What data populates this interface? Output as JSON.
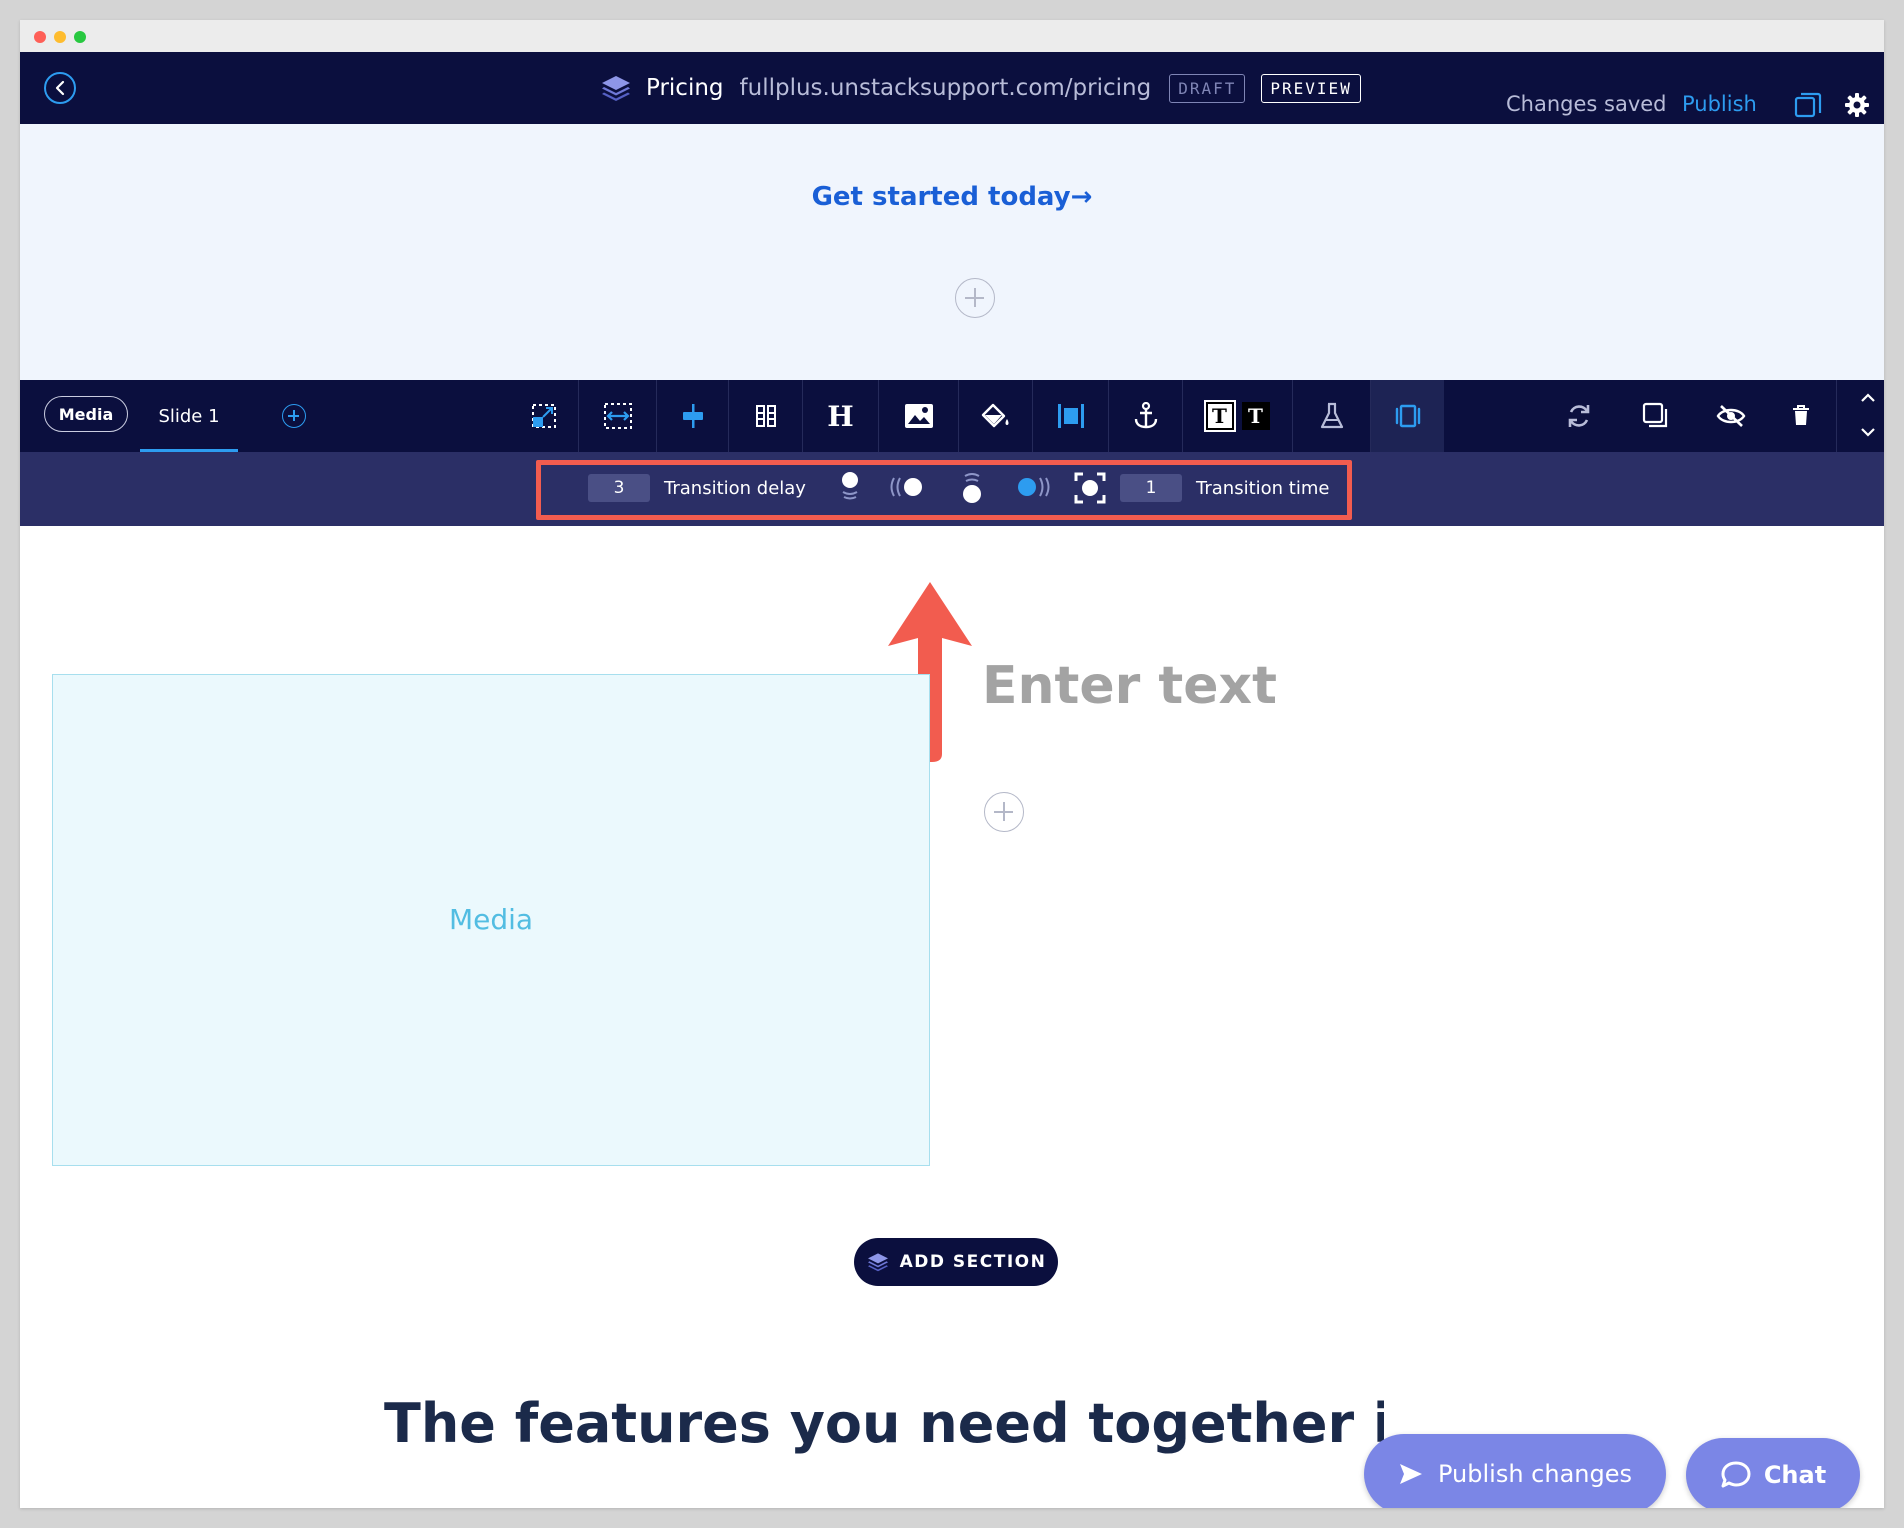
{
  "topbar": {
    "page_name": "Pricing",
    "page_url": "fullplus.unstacksupport.com/pricing",
    "draft_badge": "DRAFT",
    "preview_badge": "PREVIEW",
    "status": "Changes saved",
    "publish_label": "Publish"
  },
  "cta": {
    "link_text": "Get started today→"
  },
  "toolbar": {
    "media_pill": "Media",
    "slide_tab": "Slide 1"
  },
  "transition": {
    "delay_value": "3",
    "delay_label": "Transition delay",
    "time_value": "1",
    "time_label": "Transition time"
  },
  "content": {
    "media_label": "Media",
    "enter_text": "Enter text",
    "add_section": "ADD SECTION",
    "headline_before": "The ",
    "headline_underlined": "features you need",
    "headline_after": " together in one"
  },
  "floating": {
    "publish_changes": "Publish changes",
    "chat": "Chat"
  },
  "colors": {
    "navy": "#0b0f3e",
    "subbar": "#2b2f66",
    "accent_blue": "#2d9cf0",
    "highlight_red": "#f25c4f",
    "button_purple": "#7b86e6"
  }
}
